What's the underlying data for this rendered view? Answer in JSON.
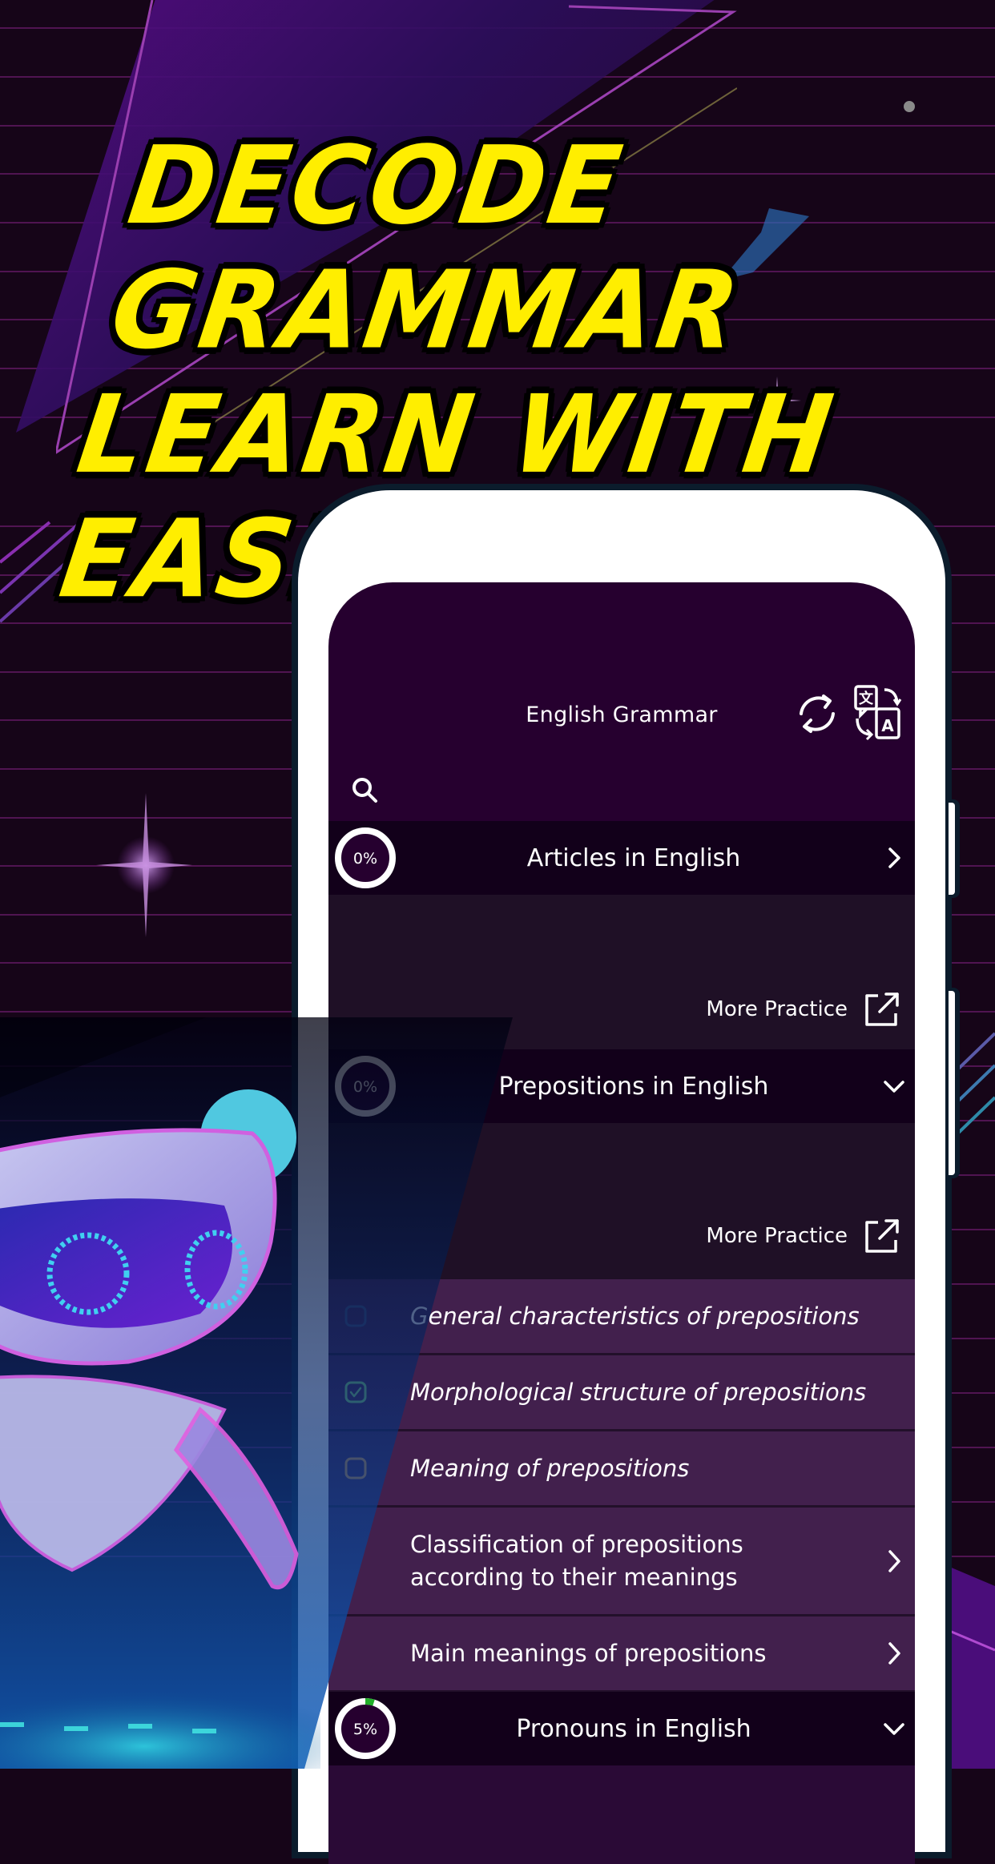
{
  "promo": {
    "headline_line1": "Decode grammar",
    "headline_line2": "Learn with ease!",
    "headline_color": "#ffee00",
    "background_color": "#160518"
  },
  "app": {
    "title": "English Grammar",
    "refresh_icon": "refresh-icon",
    "translate_icon": "translate-icon",
    "search_icon": "search-icon",
    "screen_color": "#26002f"
  },
  "sections": [
    {
      "title": "Articles in English",
      "progress_label": "0%",
      "progress": 0,
      "state": "collapsed",
      "chevron": "chevron-right-icon",
      "more_practice_label": "More Practice"
    },
    {
      "title": "Prepositions in English",
      "progress_label": "0%",
      "progress": 0,
      "state": "expanded",
      "chevron": "chevron-down-icon",
      "more_practice_label": "More Practice",
      "lessons": [
        {
          "title": "General characteristics of prepositions",
          "status": "unchecked",
          "status_color": "#3d4e78",
          "style": "italic"
        },
        {
          "title": "Morphological structure of prepositions",
          "status": "completed",
          "status_color": "#7ed97a",
          "style": "italic"
        },
        {
          "title": "Meaning of prepositions",
          "status": "in-progress",
          "status_color": "#e8a040",
          "style": "italic"
        },
        {
          "title": "Classification of prepositions according to their meanings",
          "status": "group",
          "chevron": "chevron-right-icon"
        },
        {
          "title": "Main meanings of prepositions",
          "status": "group",
          "chevron": "chevron-right-icon"
        }
      ]
    },
    {
      "title": "Pronouns in English",
      "progress_label": "5%",
      "progress": 0.05,
      "progress_color": "#22b02a",
      "state": "expanded",
      "chevron": "chevron-down-icon"
    }
  ]
}
